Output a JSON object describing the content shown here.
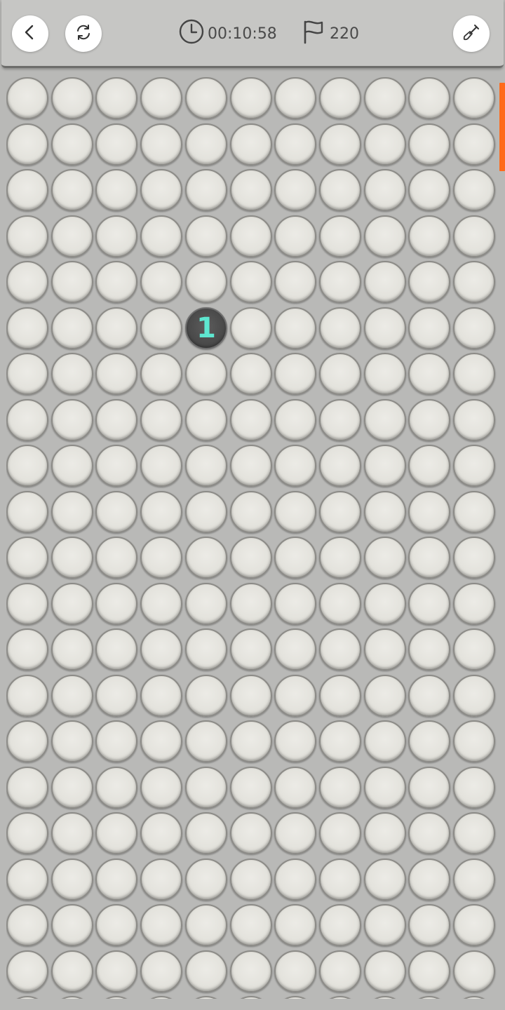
{
  "header": {
    "timer": "00:10:58",
    "flags": "220",
    "back_icon": "chevron-left-icon",
    "restart_icon": "refresh-icon",
    "timer_icon": "clock-icon",
    "flag_icon": "flag-icon",
    "tool_icon": "shovel-icon"
  },
  "board": {
    "columns": 11,
    "visible_rows": 20,
    "revealed": [
      {
        "row": 5,
        "col": 4,
        "value": "1"
      }
    ]
  },
  "colors": {
    "number_1": "#5ee7d0",
    "scroll_accent": "#ff6a1a"
  }
}
